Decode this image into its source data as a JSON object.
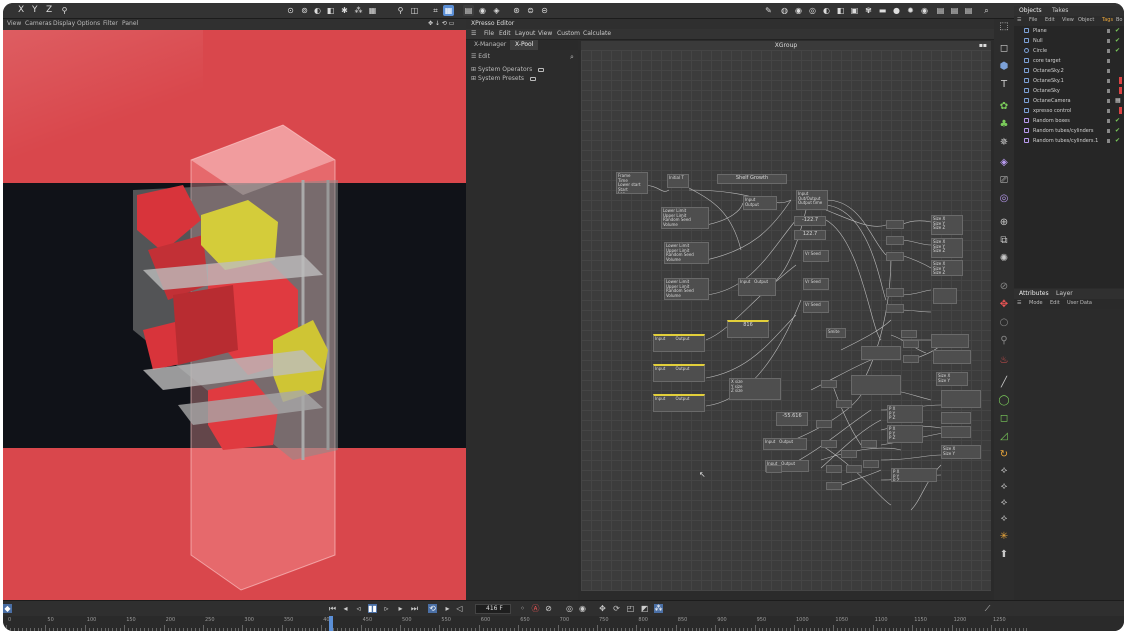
{
  "toolbar": {
    "axes": [
      "X",
      "Y",
      "Z"
    ]
  },
  "viewport": {
    "menu": [
      "View",
      "Cameras",
      "Display",
      "Options",
      "Filter",
      "Panel"
    ]
  },
  "xpresso": {
    "title": "XPresso Editor",
    "menu": [
      "File",
      "Edit",
      "Layout",
      "View",
      "Custom",
      "Calculate"
    ],
    "tabs": [
      "X-Manager",
      "X-Pool"
    ],
    "pool_header": "Edit",
    "pool_items": [
      "System Operators",
      "System Presets"
    ],
    "xgroup_title": "XGroup",
    "nodes": [
      {
        "id": "n1",
        "text": "Frame\nTime\nLower start\nStart\nLen"
      },
      {
        "id": "n2",
        "text": "Initial T"
      },
      {
        "id": "n3",
        "text": "Shelf Growth"
      },
      {
        "id": "n4",
        "text": "Input\nOutput"
      },
      {
        "id": "n5",
        "text": "Input\nOut/Output\nOutput time"
      },
      {
        "id": "n6",
        "text": "-122.7"
      },
      {
        "id": "n7",
        "text": "122.7"
      },
      {
        "id": "n8",
        "text": "Lower Limit\nUpper Limit\nRandom Seed\nVolume"
      },
      {
        "id": "n9",
        "text": "Lower Limit\nUpper Limit\nRandom Seed\nVolume"
      },
      {
        "id": "n10",
        "text": "Lower Limit\nUpper Limit\nRandom Seed\nVolume"
      },
      {
        "id": "n11",
        "text": "Vr Seed"
      },
      {
        "id": "n12",
        "text": "Vr Seed"
      },
      {
        "id": "n13",
        "text": "Vr Seed"
      },
      {
        "id": "n14",
        "text": "Input   Output"
      },
      {
        "id": "n15",
        "text": "816"
      },
      {
        "id": "n16",
        "text": "Input        Output"
      },
      {
        "id": "n17",
        "text": "Input        Output"
      },
      {
        "id": "n18",
        "text": "Input        Output"
      },
      {
        "id": "n19",
        "text": "Smite"
      },
      {
        "id": "n20",
        "text": "X size\nY size\nZ size"
      },
      {
        "id": "n21",
        "text": "-55.616"
      },
      {
        "id": "n22",
        "text": "Input   Output"
      },
      {
        "id": "n23",
        "text": "Input   Output"
      },
      {
        "id": "n24",
        "text": "Size X\nSize Y\nSize Z"
      },
      {
        "id": "n25",
        "text": "Size X\nSize Y\nSize Z"
      },
      {
        "id": "n26",
        "text": "Size X\nSize Y\nSize Z"
      },
      {
        "id": "n27",
        "text": "Size X\nSize Y"
      },
      {
        "id": "n28",
        "text": "Size X\nSize Y"
      },
      {
        "id": "n29",
        "text": "P X\nP Y\nP Z"
      },
      {
        "id": "n30",
        "text": "P X\nP Y\nP Z"
      },
      {
        "id": "n31",
        "text": "P X\nP Y\nP Z"
      }
    ]
  },
  "objects": {
    "tabs": [
      "Objects",
      "Takes"
    ],
    "menu": [
      "File",
      "Edit",
      "View",
      "Object",
      "Tags",
      "Bo"
    ],
    "items": [
      "Plane",
      "Null",
      "Circle",
      "core target",
      "OctaneSky.2",
      "OctaneSky.1",
      "OctaneSky",
      "OctaneCamera",
      "xpresso control",
      "Random boxes",
      "Random tubes/cylinders",
      "Random tubes/cylinders.1"
    ]
  },
  "attributes": {
    "tabs": [
      "Attributes",
      "Layer"
    ],
    "menu": [
      "Mode",
      "Edit",
      "User Data"
    ]
  },
  "timeline": {
    "current_frame": "416 F",
    "ticks": [
      "0",
      "50",
      "100",
      "150",
      "200",
      "250",
      "300",
      "350",
      "400",
      "450",
      "500",
      "550",
      "600",
      "650",
      "700",
      "750",
      "800",
      "850",
      "900",
      "950",
      "1000",
      "1050",
      "1100",
      "1150",
      "1200",
      "1250"
    ]
  }
}
